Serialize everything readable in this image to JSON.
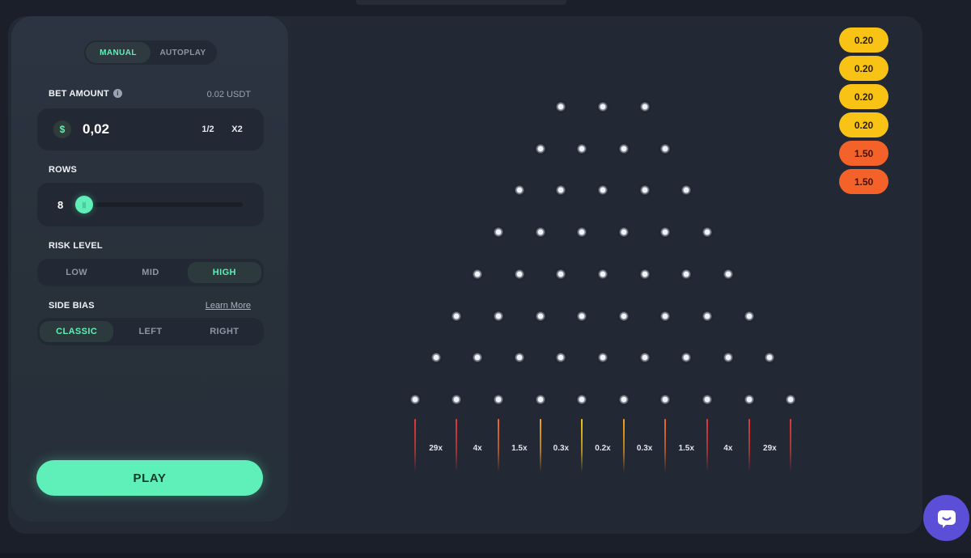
{
  "mode_tabs": [
    {
      "label": "MANUAL",
      "active": true
    },
    {
      "label": "AUTOPLAY",
      "active": false
    }
  ],
  "bet": {
    "label": "BET AMOUNT",
    "info_icon": "info-icon",
    "converted": "0.02 USDT",
    "currency_icon": "$",
    "value": "0,02",
    "half_label": "1/2",
    "double_label": "X2"
  },
  "rows": {
    "label": "ROWS",
    "value": "8",
    "thumb_glyph": "||",
    "min": 8,
    "max": 16
  },
  "risk": {
    "label": "RISK LEVEL",
    "options": [
      "LOW",
      "MID",
      "HIGH"
    ],
    "selected": "HIGH"
  },
  "side_bias": {
    "label": "SIDE BIAS",
    "learn_more": "Learn More",
    "options": [
      "CLASSIC",
      "LEFT",
      "RIGHT"
    ],
    "selected": "CLASSIC"
  },
  "play_label": "PLAY",
  "board": {
    "peg_rows": [
      3,
      4,
      5,
      6,
      7,
      8,
      9,
      10
    ],
    "multipliers": [
      "29x",
      "4x",
      "1.5x",
      "0.3x",
      "0.2x",
      "0.3x",
      "1.5x",
      "4x",
      "29x"
    ],
    "divider_colors": [
      "#e23a3a",
      "#e23a3a",
      "#f06a2a",
      "#f2a41c",
      "#f5c518",
      "#f2a41c",
      "#f06a2a",
      "#e23a3a",
      "#e23a3a",
      "#e23a3a"
    ]
  },
  "history": [
    {
      "value": "0.20",
      "color": "#f8c315"
    },
    {
      "value": "0.20",
      "color": "#f8c315"
    },
    {
      "value": "0.20",
      "color": "#f8c315"
    },
    {
      "value": "0.20",
      "color": "#f8c315"
    },
    {
      "value": "1.50",
      "color": "#f4622a"
    },
    {
      "value": "1.50",
      "color": "#f4622a"
    }
  ],
  "colors": {
    "accent": "#5ef0b8",
    "chat": "#5a4fd6"
  }
}
